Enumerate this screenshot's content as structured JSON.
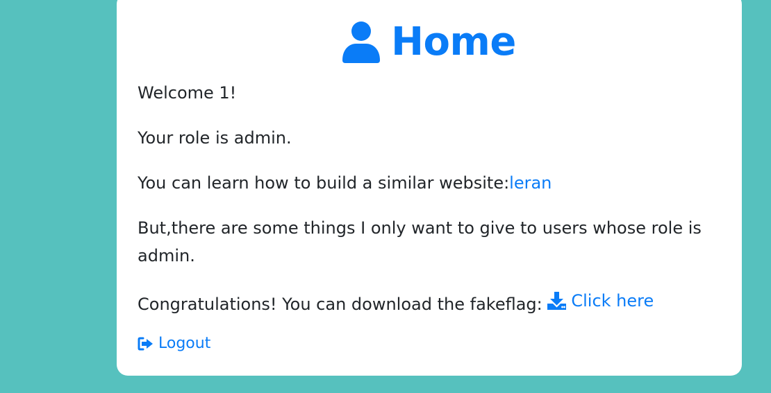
{
  "header": {
    "title": "Home",
    "icon": "user-icon",
    "color": "#0a7cf7"
  },
  "content": {
    "welcome": "Welcome 1!",
    "role_text": "Your role is admin.",
    "learn_text": "You can learn how to build a similar website:",
    "learn_link": "leran",
    "admin_note": "But,there are some things I only want to give to users whose role is admin.",
    "congrats_text": "Congratulations! You can download the fakeflag: ",
    "download_icon": "download-icon",
    "download_link": "Click here"
  },
  "footer": {
    "logout_icon": "sign-out-icon",
    "logout_label": "Logout"
  },
  "colors": {
    "background": "#56c1be",
    "card": "#ffffff",
    "accent": "#0a7cf7"
  }
}
